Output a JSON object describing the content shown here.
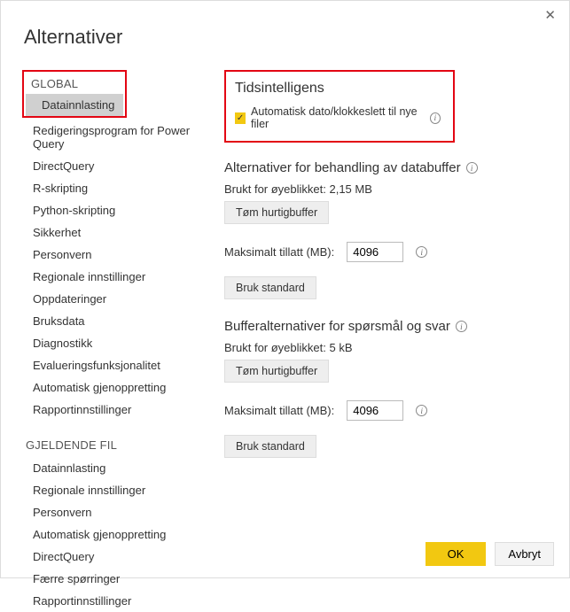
{
  "dialog": {
    "title": "Alternativer",
    "close": "✕"
  },
  "sidebar": {
    "global_header": "GLOBAL",
    "global_items": [
      "Datainnlasting",
      "Redigeringsprogram for Power Query",
      "DirectQuery",
      "R-skripting",
      "Python-skripting",
      "Sikkerhet",
      "Personvern",
      "Regionale innstillinger",
      "Oppdateringer",
      "Bruksdata",
      "Diagnostikk",
      "Evalueringsfunksjonalitet",
      "Automatisk gjenoppretting",
      "Rapportinnstillinger"
    ],
    "current_header": "GJELDENDE FIL",
    "current_items": [
      "Datainnlasting",
      "Regionale innstillinger",
      "Personvern",
      "Automatisk gjenoppretting",
      "DirectQuery",
      "Færre spørringer",
      "Rapportinnstillinger"
    ]
  },
  "content": {
    "time_intel": {
      "title": "Tidsintelligens",
      "checkbox_label": "Automatisk dato/klokkeslett til nye filer"
    },
    "databuffer": {
      "title": "Alternativer for behandling av databuffer",
      "used_label": "Brukt for øyeblikket: 2,15 MB",
      "clear_btn": "Tøm hurtigbuffer",
      "max_label": "Maksimalt tillatt (MB):",
      "max_value": "4096",
      "default_btn": "Bruk standard"
    },
    "qabuffer": {
      "title": "Bufferalternativer for spørsmål og svar",
      "used_label": "Brukt for øyeblikket: 5 kB",
      "clear_btn": "Tøm hurtigbuffer",
      "max_label": "Maksimalt tillatt (MB):",
      "max_value": "4096",
      "default_btn": "Bruk standard"
    }
  },
  "footer": {
    "ok": "OK",
    "cancel": "Avbryt"
  }
}
